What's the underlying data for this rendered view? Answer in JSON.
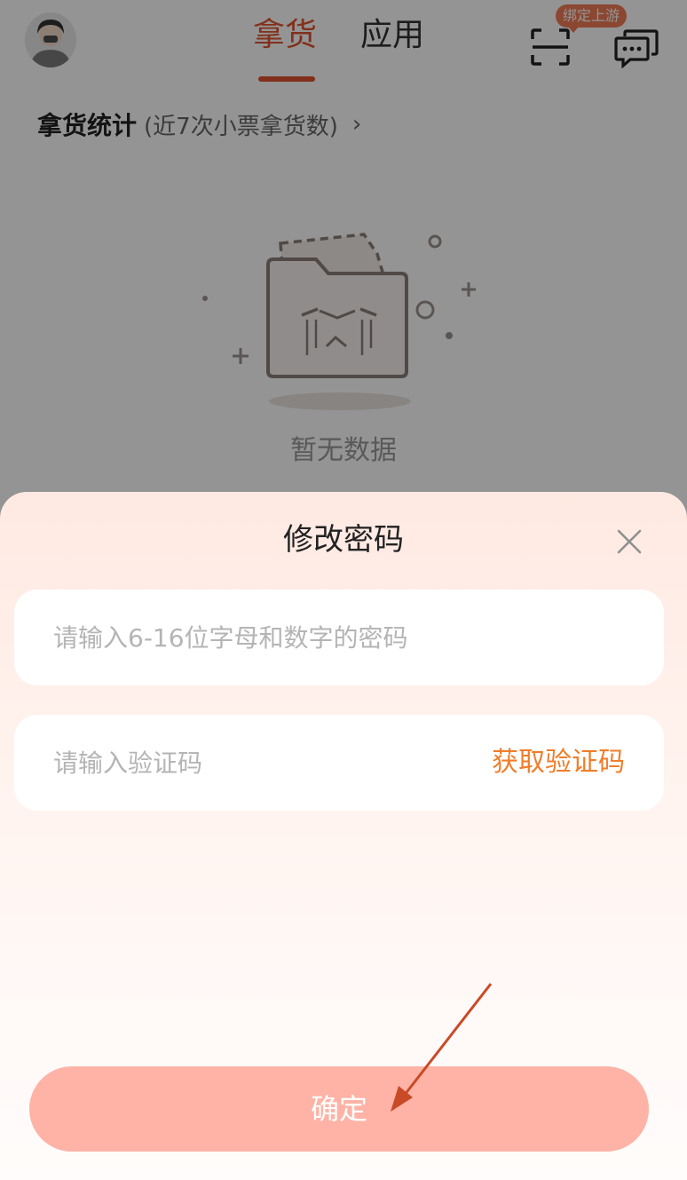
{
  "header": {
    "tabs": [
      {
        "label": "拿货",
        "active": true
      },
      {
        "label": "应用",
        "active": false
      }
    ],
    "bind_badge": "绑定上游",
    "icons": {
      "avatar": "user-avatar",
      "scan": "scan-icon",
      "message": "message-icon"
    }
  },
  "stats": {
    "title": "拿货统计",
    "subtitle": "(近7次小票拿货数)",
    "chevron": "›",
    "empty_text": "暂无数据"
  },
  "dialog": {
    "title": "修改密码",
    "close_icon": "close-icon",
    "password_placeholder": "请输入6-16位字母和数字的密码",
    "code_placeholder": "请输入验证码",
    "get_code_label": "获取验证码",
    "confirm_label": "确定"
  },
  "colors": {
    "accent": "#e0532f",
    "get_code": "#f07d2a",
    "confirm_button": "#feb3a6",
    "annotation_arrow": "#c94a26"
  }
}
